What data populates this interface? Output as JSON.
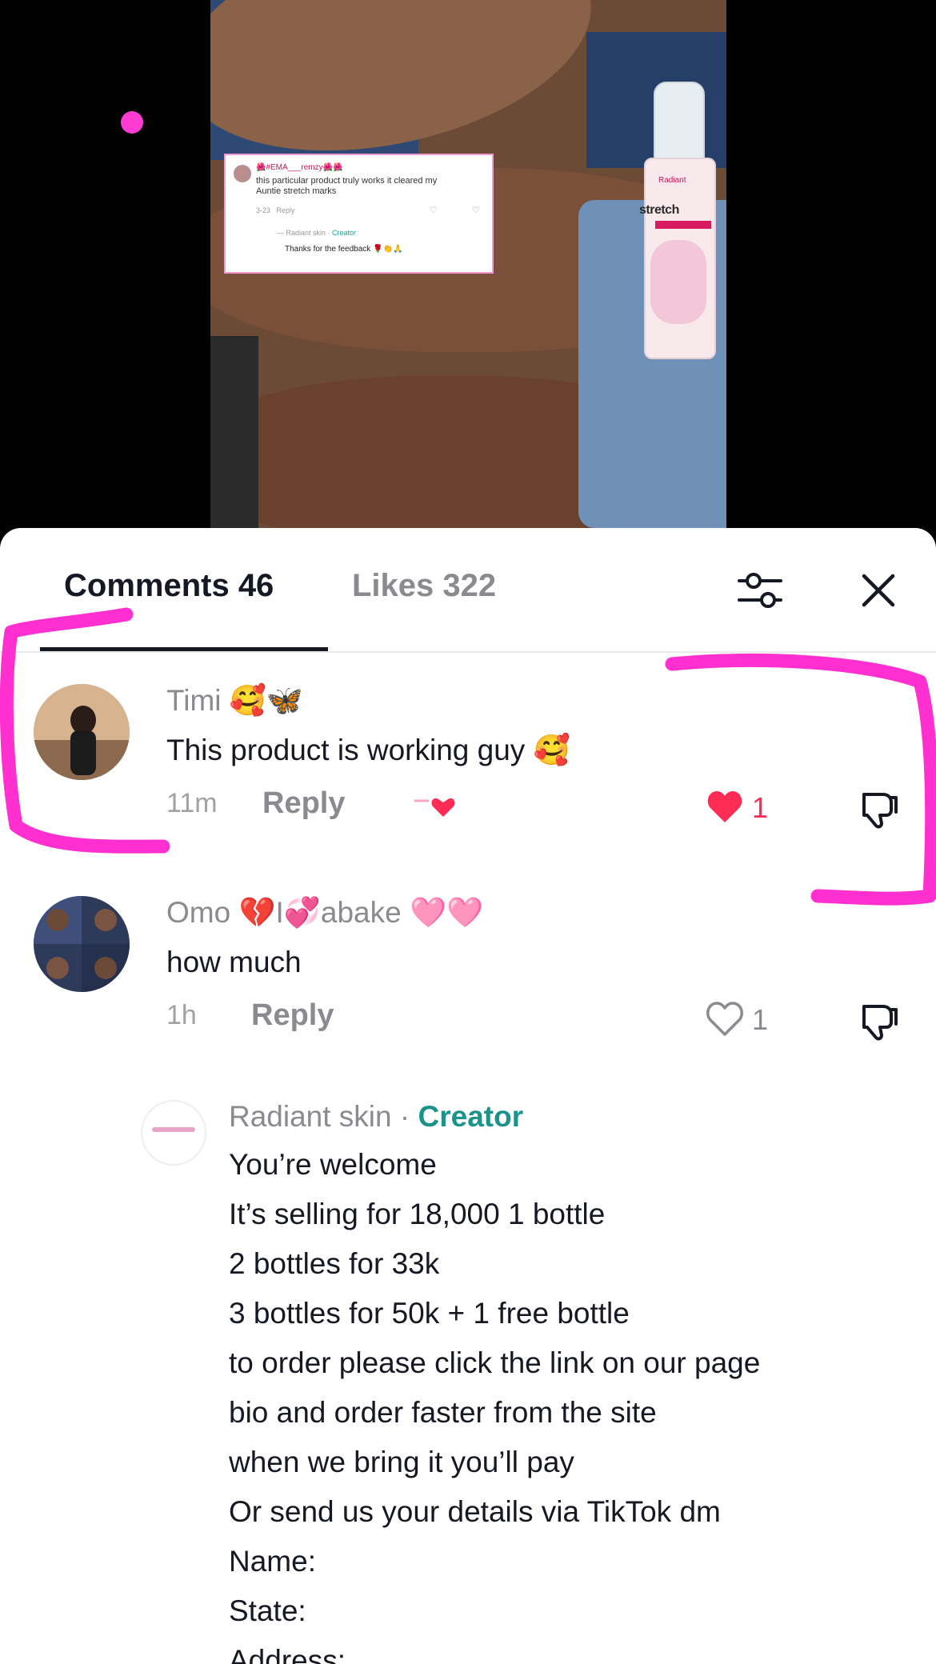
{
  "video": {
    "quote_card": {
      "username": "🌺#EMA___remzy🌺🌺",
      "comment": "this particular product truly works it cleared my Auntie stretch marks",
      "time": "3-23",
      "reply_label": "Reply",
      "reply_user": "Radiant skin",
      "reply_creator": "Creator",
      "reply_text": "Thanks for the feedback 🌹👏🙏"
    },
    "product": {
      "brand": "Radiant",
      "name": "stretch"
    }
  },
  "sheet": {
    "tabs": [
      {
        "label": "Comments 46",
        "active": true
      },
      {
        "label": "Likes 322",
        "active": false
      }
    ],
    "filter_icon": "sliders-icon",
    "close_icon": "close-icon"
  },
  "comments": [
    {
      "username": "Timi 🥰🦋",
      "text": "This product is working guy 🥰",
      "time": "11m",
      "reply_label": "Reply",
      "creator_liked": true,
      "liked": true,
      "like_count": "1"
    },
    {
      "username": "Omo 💔I💞abake 🩷🩷",
      "text": "how much",
      "time": "1h",
      "reply_label": "Reply",
      "liked": false,
      "like_count": "1"
    }
  ],
  "creator_reply": {
    "username": "Radiant skin",
    "separator": "·",
    "badge": "Creator",
    "lines": [
      "You’re welcome",
      "It’s selling for 18,000 1 bottle",
      "2 bottles for 33k",
      "3 bottles for 50k + 1 free bottle",
      "to order please click the link on our page",
      "bio and order faster from the site",
      "when we bring it you’ll pay",
      "Or send us your details via TikTok dm",
      "Name:",
      "State:",
      "Address:"
    ]
  },
  "colors": {
    "accent_red": "#fe2c55",
    "creator_teal": "#1c938a",
    "annotation_magenta": "#ff2fd0"
  }
}
